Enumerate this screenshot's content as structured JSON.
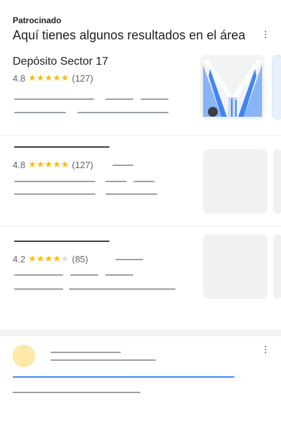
{
  "header": {
    "sponsored_label": "Patrocinado",
    "title": "Aquí tienes algunos resultados en el área"
  },
  "results": [
    {
      "name": "Depósito Sector 17",
      "rating": "4.8",
      "stars": "★★★★★",
      "empty_stars": "",
      "count": "(127)"
    },
    {
      "name": "",
      "rating": "4.8",
      "stars": "★★★★★",
      "empty_stars": "",
      "count": "(127)"
    },
    {
      "name": "",
      "rating": "4.2",
      "stars": "★★★★",
      "empty_stars": "★",
      "count": "(85)"
    }
  ],
  "icons": {
    "more": "more-vert-icon",
    "star": "star-icon"
  },
  "colors": {
    "star": "#fbbc04",
    "text": "#202124",
    "muted": "#5f6368",
    "placeholder": "#9aa0a6",
    "link_blue": "#4285f4",
    "avatar": "#fde9a8"
  }
}
